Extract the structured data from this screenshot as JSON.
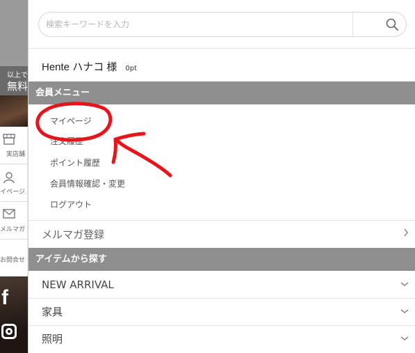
{
  "background": {
    "promo_line1": "以上で",
    "promo_line2": "無料",
    "nav": [
      {
        "icon": "store-icon",
        "label": "実店舗"
      },
      {
        "icon": "person-icon",
        "label": "マイページ"
      },
      {
        "icon": "mail-icon",
        "label": "メルマガ"
      },
      {
        "icon": "",
        "label": "お問合せ"
      }
    ]
  },
  "search": {
    "placeholder": "検索キーワードを入力",
    "value": "",
    "icon": "search-icon"
  },
  "user": {
    "name": "Hente ハナコ 様",
    "points": "0pt"
  },
  "member_menu": {
    "heading": "会員メニュー",
    "items": [
      "マイページ",
      "注文履歴",
      "ポイント履歴",
      "会員情報確認・変更",
      "ログアウト"
    ]
  },
  "newsletter": {
    "label": "メルマガ登録",
    "chevron": "chevron-right-icon"
  },
  "items_section": {
    "heading": "アイテムから探す",
    "categories": [
      {
        "label": "NEW ARRIVAL",
        "chevron": "chevron-down-icon"
      },
      {
        "label": "家具",
        "chevron": "chevron-down-icon"
      },
      {
        "label": "照明",
        "chevron": "chevron-down-icon"
      }
    ]
  },
  "annotation": {
    "color": "#e8141c"
  }
}
